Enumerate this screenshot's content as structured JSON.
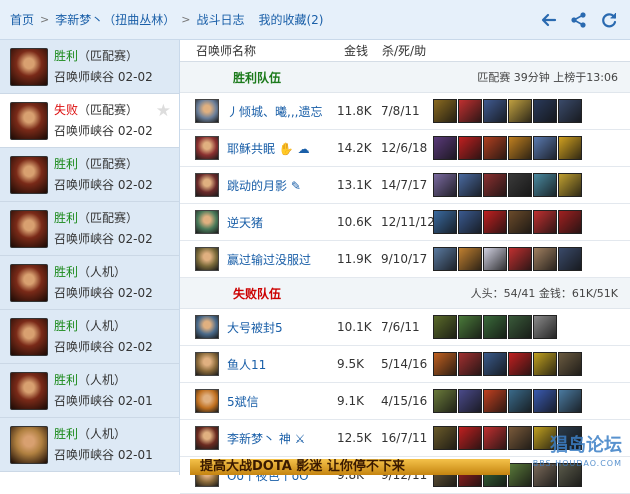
{
  "breadcrumb": {
    "home": "首页",
    "player": "李新梦丶（扭曲丛林）",
    "log": "战斗日志",
    "fav": "我的收藏(2)"
  },
  "toolbar_icons": [
    "back-arrow-icon",
    "share-icon",
    "refresh-icon"
  ],
  "matches": [
    {
      "result": "胜利",
      "result_type": "win",
      "mode": "（匹配赛）",
      "map": "召唤师峡谷",
      "date": "02-02",
      "avatar": "#7a2a18",
      "selected": false
    },
    {
      "result": "失败",
      "result_type": "lose",
      "mode": "（匹配赛）",
      "map": "召唤师峡谷",
      "date": "02-02",
      "avatar": "#7a2a18",
      "selected": true
    },
    {
      "result": "胜利",
      "result_type": "win",
      "mode": "（匹配赛）",
      "map": "召唤师峡谷",
      "date": "02-02",
      "avatar": "#7a2a18",
      "selected": false
    },
    {
      "result": "胜利",
      "result_type": "win",
      "mode": "（匹配赛）",
      "map": "召唤师峡谷",
      "date": "02-02",
      "avatar": "#7a2a18",
      "selected": false
    },
    {
      "result": "胜利",
      "result_type": "win",
      "mode": "（人机）",
      "map": "召唤师峡谷",
      "date": "02-02",
      "avatar": "#7a2a18",
      "selected": false
    },
    {
      "result": "胜利",
      "result_type": "win",
      "mode": "（人机）",
      "map": "召唤师峡谷",
      "date": "02-02",
      "avatar": "#7a2a18",
      "selected": false
    },
    {
      "result": "胜利",
      "result_type": "win",
      "mode": "（人机）",
      "map": "召唤师峡谷",
      "date": "02-01",
      "avatar": "#7a2a18",
      "selected": false
    },
    {
      "result": "胜利",
      "result_type": "win",
      "mode": "（人机）",
      "map": "召唤师峡谷",
      "date": "02-01",
      "avatar": "#b08040",
      "selected": false
    }
  ],
  "table_header": {
    "name": "召唤师名称",
    "gold": "金钱",
    "kda": "杀/死/助"
  },
  "win_team": {
    "label": "胜利队伍",
    "info": "匹配赛 39分钟 上榜于13:06"
  },
  "lose_team": {
    "label": "失败队伍",
    "info": "人头：54/41 金钱：61K/51K"
  },
  "win_players": [
    {
      "name": "丿倾城、曦,,,遗忘",
      "gold": "11.8K",
      "kda": "7/8/11",
      "avatar": "#6b7f9a",
      "items": [
        "#8a6a20",
        "#c03030",
        "#405a90",
        "#c0a040",
        "#2a3a5a",
        "#3a4a6a"
      ]
    },
    {
      "name": "耶稣共眠 ✋ ☁",
      "gold": "14.2K",
      "kda": "12/6/18",
      "avatar": "#8a3030",
      "items": [
        "#5a3a7a",
        "#c02020",
        "#b04020",
        "#c08020",
        "#5a7ab0",
        "#d0a020"
      ]
    },
    {
      "name": "跳动的月影 ✎",
      "gold": "13.1K",
      "kda": "14/7/17",
      "avatar": "#6a2a2a",
      "items": [
        "#7a6aa0",
        "#4a6aa0",
        "#8a3030",
        "#3a3a3a",
        "#4a8aa0",
        "#c0a030"
      ]
    },
    {
      "name": "逆天猪",
      "gold": "10.6K",
      "kda": "12/11/12",
      "avatar": "#4a7a5a",
      "items": [
        "#3a6aa0",
        "#3a5a90",
        "#c02020",
        "#6a4a2a",
        "#c03030",
        "#a02020"
      ]
    },
    {
      "name": "赢过输过没服过",
      "gold": "11.9K",
      "kda": "9/10/17",
      "avatar": "#7a6a3a",
      "items": [
        "#5a7aa0",
        "#c08030",
        "#d0d0e0",
        "#c03030",
        "#a08060",
        "#3a4a6a"
      ]
    }
  ],
  "lose_players": [
    {
      "name": "大号被封5",
      "gold": "10.1K",
      "kda": "7/6/11",
      "avatar": "#4a6a8a",
      "items": [
        "#5a6a2a",
        "#4a7a3a",
        "#3a6a3a",
        "#3a5a3a",
        "#8a8a8a"
      ]
    },
    {
      "name": "鱼人11",
      "gold": "9.5K",
      "kda": "5/14/16",
      "avatar": "#8a6a3a",
      "items": [
        "#c06020",
        "#a03030",
        "#3a5a8a",
        "#c02020",
        "#c0a020",
        "#6a5a40"
      ]
    },
    {
      "name": "5斌信",
      "gold": "9.1K",
      "kda": "4/15/16",
      "avatar": "#c07020",
      "items": [
        "#6a7a3a",
        "#4a4a8a",
        "#c04020",
        "#3a6a8a",
        "#3a5ab0",
        "#4a7aa0"
      ]
    },
    {
      "name": "李新梦丶 神 ⚔",
      "gold": "12.5K",
      "kda": "16/7/11",
      "avatar": "#6a2a20",
      "items": [
        "#6a5a2a",
        "#c02020",
        "#c03030",
        "#7a5a3a",
        "#c0a020",
        "#2a3a4a"
      ]
    },
    {
      "name": "Oo丨夜色丨oO",
      "gold": "9.8K",
      "kda": "9/12/11",
      "avatar": "#8a6a3a",
      "items": [
        "#6a5a3a",
        "#a02020",
        "#3a6a3a",
        "#5a7a3a",
        "#7a6a5a",
        "#5a5a4a"
      ]
    }
  ],
  "ad": {
    "text": "提高大战DOTA  影迷 让你停不下来"
  },
  "watermark": {
    "main": "猖岛论坛",
    "sub": "BBS.HOUDAO.COM"
  }
}
